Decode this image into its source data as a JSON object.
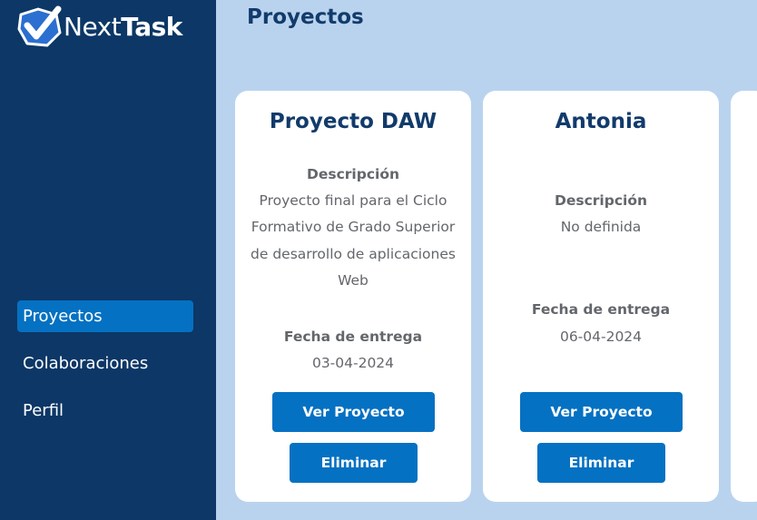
{
  "brand": {
    "name_light": "Next",
    "name_bold": "Task"
  },
  "colors": {
    "sidebar": "#0c3766",
    "accent": "#0571c2",
    "background": "#b9d3ee",
    "title": "#123b6b",
    "muted_text": "#63666b"
  },
  "sidebar": {
    "items": [
      {
        "label": "Proyectos",
        "active": true
      },
      {
        "label": "Colaboraciones",
        "active": false
      },
      {
        "label": "Perfil",
        "active": false
      }
    ]
  },
  "header": {
    "title": "Proyectos"
  },
  "projects": [
    {
      "name": "Proyecto DAW",
      "description_label": "Descripción",
      "description_lines": [
        "Proyecto final para el Ciclo",
        "Formativo de Grado Superior",
        "de desarrollo de aplicaciones",
        "Web"
      ],
      "due_label": "Fecha de entrega",
      "due_date": "03-04-2024",
      "view_label": "Ver Proyecto",
      "delete_label": "Eliminar"
    },
    {
      "name": "Antonia",
      "description_label": "Descripción",
      "description_lines": [
        "No definida"
      ],
      "due_label": "Fecha de entrega",
      "due_date": "06-04-2024",
      "view_label": "Ver Proyecto",
      "delete_label": "Eliminar"
    }
  ]
}
